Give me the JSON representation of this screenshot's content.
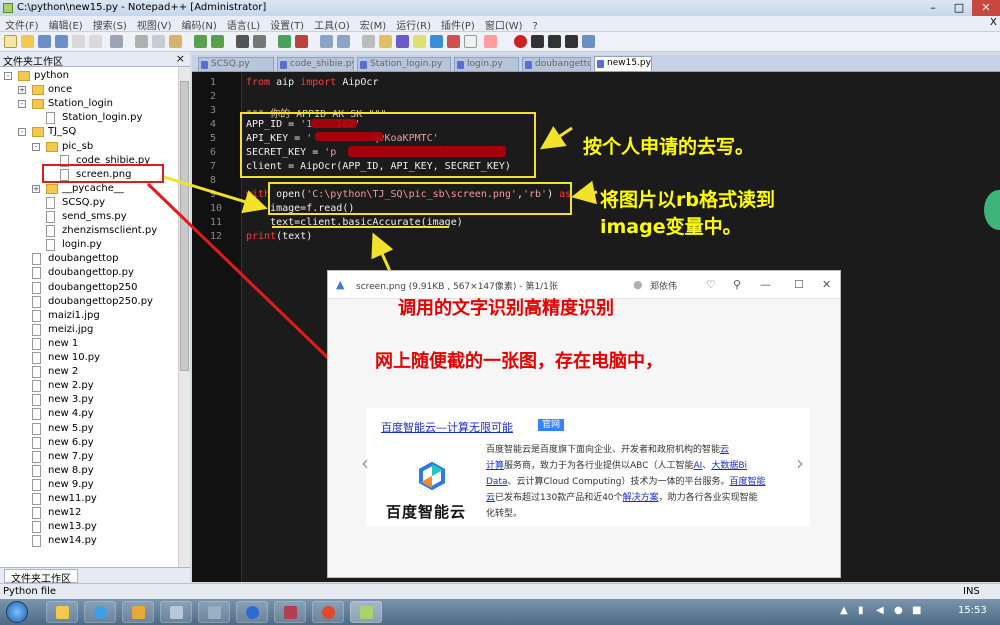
{
  "window": {
    "title": "C:\\python\\new15.py - Notepad++ [Administrator]",
    "min": "–",
    "max": "□",
    "close": "✕"
  },
  "menu": [
    "文件(F)",
    "编辑(E)",
    "搜索(S)",
    "视图(V)",
    "编码(N)",
    "语言(L)",
    "设置(T)",
    "工具(O)",
    "宏(M)",
    "运行(R)",
    "插件(P)",
    "窗口(W)",
    "?"
  ],
  "close_x": "X",
  "panel": {
    "title": "文件夹工作区",
    "close": "×",
    "bottom_tab": "文件夹工作区"
  },
  "tree": [
    {
      "label": "python",
      "depth": 0,
      "kind": "folder",
      "exp": "-"
    },
    {
      "label": "once",
      "depth": 1,
      "kind": "folder",
      "exp": "+"
    },
    {
      "label": "Station_login",
      "depth": 1,
      "kind": "folder",
      "exp": "-"
    },
    {
      "label": "Station_login.py",
      "depth": 2,
      "kind": "file",
      "exp": ""
    },
    {
      "label": "TJ_SQ",
      "depth": 1,
      "kind": "folder",
      "exp": "-"
    },
    {
      "label": "pic_sb",
      "depth": 2,
      "kind": "folder",
      "exp": "-"
    },
    {
      "label": "code_shibie.py",
      "depth": 3,
      "kind": "file",
      "exp": ""
    },
    {
      "label": "screen.png",
      "depth": 3,
      "kind": "file",
      "exp": ""
    },
    {
      "label": "__pycache__",
      "depth": 2,
      "kind": "folder",
      "exp": "+"
    },
    {
      "label": "SCSQ.py",
      "depth": 2,
      "kind": "file",
      "exp": ""
    },
    {
      "label": "send_sms.py",
      "depth": 2,
      "kind": "file",
      "exp": ""
    },
    {
      "label": "zhenzismsclient.py",
      "depth": 2,
      "kind": "file",
      "exp": ""
    },
    {
      "label": "login.py",
      "depth": 2,
      "kind": "file",
      "exp": ""
    },
    {
      "label": "doubangettop",
      "depth": 1,
      "kind": "file",
      "exp": ""
    },
    {
      "label": "doubangettop.py",
      "depth": 1,
      "kind": "file",
      "exp": ""
    },
    {
      "label": "doubangettop250",
      "depth": 1,
      "kind": "file",
      "exp": ""
    },
    {
      "label": "doubangettop250.py",
      "depth": 1,
      "kind": "file",
      "exp": ""
    },
    {
      "label": "maizi1.jpg",
      "depth": 1,
      "kind": "file",
      "exp": ""
    },
    {
      "label": "meizi.jpg",
      "depth": 1,
      "kind": "file",
      "exp": ""
    },
    {
      "label": "new 1",
      "depth": 1,
      "kind": "file",
      "exp": ""
    },
    {
      "label": "new 10.py",
      "depth": 1,
      "kind": "file",
      "exp": ""
    },
    {
      "label": "new 2",
      "depth": 1,
      "kind": "file",
      "exp": ""
    },
    {
      "label": "new 2.py",
      "depth": 1,
      "kind": "file",
      "exp": ""
    },
    {
      "label": "new 3.py",
      "depth": 1,
      "kind": "file",
      "exp": ""
    },
    {
      "label": "new 4.py",
      "depth": 1,
      "kind": "file",
      "exp": ""
    },
    {
      "label": "new 5.py",
      "depth": 1,
      "kind": "file",
      "exp": ""
    },
    {
      "label": "new 6.py",
      "depth": 1,
      "kind": "file",
      "exp": ""
    },
    {
      "label": "new 7.py",
      "depth": 1,
      "kind": "file",
      "exp": ""
    },
    {
      "label": "new 8.py",
      "depth": 1,
      "kind": "file",
      "exp": ""
    },
    {
      "label": "new 9.py",
      "depth": 1,
      "kind": "file",
      "exp": ""
    },
    {
      "label": "new11.py",
      "depth": 1,
      "kind": "file",
      "exp": ""
    },
    {
      "label": "new12",
      "depth": 1,
      "kind": "file",
      "exp": ""
    },
    {
      "label": "new13.py",
      "depth": 1,
      "kind": "file",
      "exp": ""
    },
    {
      "label": "new14.py",
      "depth": 1,
      "kind": "file",
      "exp": ""
    }
  ],
  "tabs": [
    {
      "label": "SCSQ.py",
      "active": false
    },
    {
      "label": "code_shibie.py",
      "active": false
    },
    {
      "label": "Station_login.py",
      "active": false
    },
    {
      "label": "login.py",
      "active": false
    },
    {
      "label": "doubangettop",
      "active": false
    },
    {
      "label": "new15.py",
      "active": true
    }
  ],
  "code_lines": [
    {
      "n": "1",
      "text": "from aip import AipOcr"
    },
    {
      "n": "2",
      "text": ""
    },
    {
      "n": "3",
      "text": "\"\"\" 你的 APPID AK SK \"\"\""
    },
    {
      "n": "4",
      "text": "APP_ID = '1    162'"
    },
    {
      "n": "5",
      "text": "API_KEY = '          qvKoaKPMTC'"
    },
    {
      "n": "6",
      "text": "SECRET_KEY = 'p                  '"
    },
    {
      "n": "7",
      "text": "client = AipOcr(APP_ID, API_KEY, SECRET_KEY)"
    },
    {
      "n": "8",
      "text": ""
    },
    {
      "n": "9",
      "text": "with open('C:\\python\\TJ_SQ\\pic_sb\\screen.png','rb') as f:"
    },
    {
      "n": "10",
      "text": "    image=f.read()"
    },
    {
      "n": "11",
      "text": "    text=client.basicAccurate(image)"
    },
    {
      "n": "12",
      "text": "print(text)"
    }
  ],
  "annotations": {
    "a1": "按个人申请的去写。",
    "a2": "将图片以rb格式读到",
    "a3": "image变量中。",
    "a4": "调用的文字识别高精度识别",
    "a5": "网上随便截的一张图，存在电脑中，"
  },
  "viewer": {
    "title": "screen.png (9.91KB , 567×147像素) - 第1/1张",
    "owner": "郑依伟",
    "icons": {
      "shirt": "♡",
      "pin": "⚲",
      "min": "—",
      "max": "☐",
      "close": "✕"
    }
  },
  "pic": {
    "brand": "百度智能云—计算无限可能",
    "badge": "官网",
    "desc_1": "百度智能云是百度旗下面向企业、开发者和政府机构的智能",
    "desc_1b": "云",
    "desc_2a": "计算",
    "desc_2b": "服务商，致力于为各行业提供以ABC（人工智能",
    "desc_2c": "AI",
    "desc_2d": "、",
    "desc_2e": "大数据Bi",
    "desc_3a": "Data",
    "desc_3b": "、云计算Cloud Computing）技术为一体的平台服务。",
    "desc_3c": "百度智能",
    "desc_4a": "云",
    "desc_4b": "已发布超过130款产品和近40个",
    "desc_4c": "解决方案",
    "desc_4d": "，助力各行各业实现智能",
    "desc_5": "化转型。",
    "logo_text": "百度智能云",
    "prev": "‹",
    "next": "›"
  },
  "status": {
    "file_type": "Python file",
    "ins": "INS"
  },
  "taskbar": {
    "time": "15:53"
  },
  "colors": {
    "annotation_yellow": "#ffff00",
    "annotation_red": "#e60000",
    "box_yellow": "#f2e22a",
    "box_red": "#e21a1a",
    "editor_bg": "#1b1b1b",
    "link_blue": "#1b2fd0"
  }
}
